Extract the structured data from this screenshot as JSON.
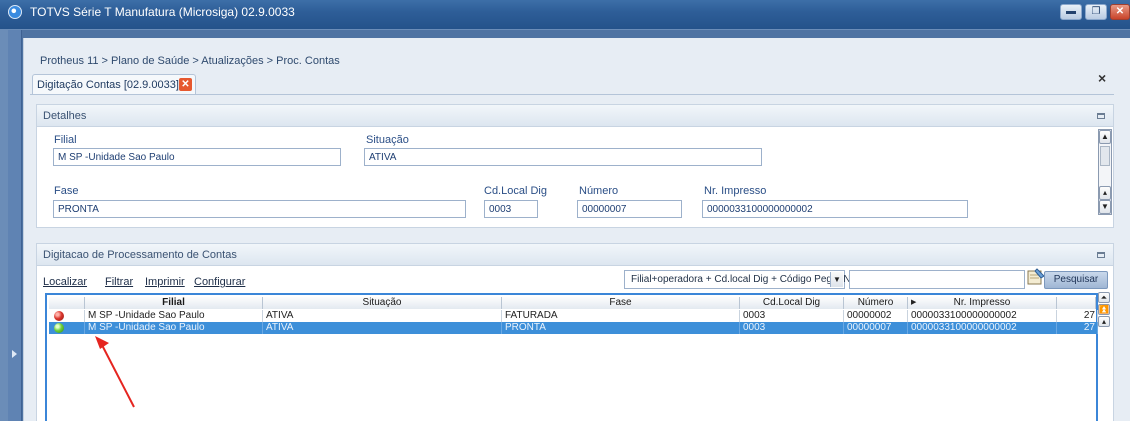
{
  "window": {
    "title": "TOTVS Série T Manufatura (Microsiga) 02.9.0033",
    "app_icon": "protheus-icon",
    "buttons": [
      "minimize-icon",
      "restore-icon",
      "close-icon"
    ]
  },
  "breadcrumb": "Protheus 11 > Plano de Saúde > Atualizações > Proc. Contas",
  "doc_tab": {
    "label": "Digitação Contas [02.9.0033]",
    "close_symbol": "✕"
  },
  "close_all_symbol": "×",
  "detalhes": {
    "title": "Detalhes",
    "fields": {
      "filial": {
        "label": "Filial",
        "value": "M SP   -Unidade Sao Paulo"
      },
      "situacao": {
        "label": "Situação",
        "value": "ATIVA"
      },
      "fase": {
        "label": "Fase",
        "value": "PRONTA"
      },
      "cd_local_dig": {
        "label": "Cd.Local Dig",
        "value": "0003"
      },
      "numero": {
        "label": "Número",
        "value": "00000007"
      },
      "nr_impresso": {
        "label": "Nr. Impresso",
        "value": "0000033100000000002"
      }
    }
  },
  "processamento": {
    "title": "Digitacao de Processamento de Contas",
    "toolbar": {
      "localizar": "Localizar",
      "filtrar": "Filtrar",
      "imprimir": "Imprimir",
      "configurar": "Configurar",
      "index_value": "Filial+operadora + Cd.local Dig + Código Peg + Núm",
      "search_value": "",
      "search_button": "Pesquisar"
    },
    "grid": {
      "columns": [
        "",
        "Filial",
        "Situação",
        "Fase",
        "Cd.Local Dig",
        "Número",
        "Nr. Impresso",
        ""
      ],
      "rows": [
        {
          "status_color": "#d9342b",
          "filial": "M SP   -Unidade Sao Paulo",
          "situacao": "ATIVA",
          "fase": "FATURADA",
          "cd_local_dig": "0003",
          "numero": "00000002",
          "nr_impresso": "0000033100000000002",
          "extra": "27"
        },
        {
          "status_color": "#6fcf3a",
          "filial": "M SP   -Unidade Sao Paulo",
          "situacao": "ATIVA",
          "fase": "PRONTA",
          "cd_local_dig": "0003",
          "numero": "00000007",
          "nr_impresso": "0000033100000000002",
          "extra": "27"
        }
      ],
      "selected_row": 1
    }
  }
}
